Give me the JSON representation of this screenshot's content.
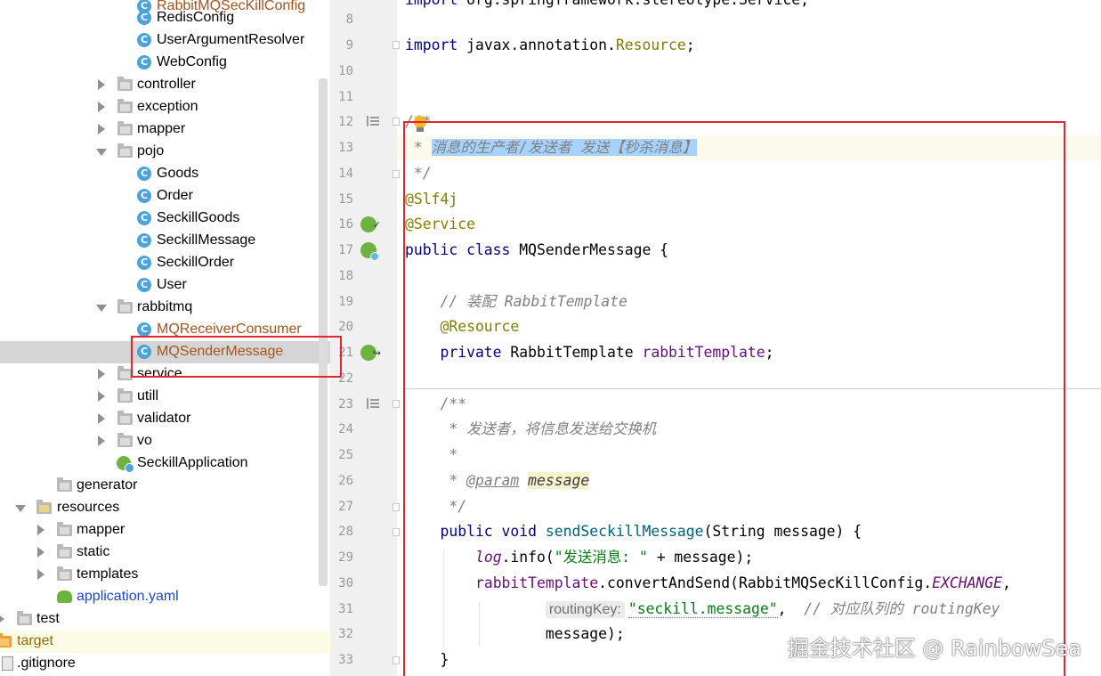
{
  "tree": {
    "items": [
      {
        "label": "RabbitMQSecKillConfig",
        "kind": "class",
        "partial": true
      },
      {
        "label": "RedisConfig",
        "kind": "class"
      },
      {
        "label": "UserArgumentResolver",
        "kind": "class"
      },
      {
        "label": "WebConfig",
        "kind": "class"
      },
      {
        "label": "controller",
        "kind": "folder",
        "state": "collapsed"
      },
      {
        "label": "exception",
        "kind": "folder",
        "state": "collapsed"
      },
      {
        "label": "mapper",
        "kind": "folder",
        "state": "collapsed"
      },
      {
        "label": "pojo",
        "kind": "folder",
        "state": "expanded"
      },
      {
        "label": "Goods",
        "kind": "class"
      },
      {
        "label": "Order",
        "kind": "class"
      },
      {
        "label": "SeckillGoods",
        "kind": "class"
      },
      {
        "label": "SeckillMessage",
        "kind": "class"
      },
      {
        "label": "SeckillOrder",
        "kind": "class"
      },
      {
        "label": "User",
        "kind": "class"
      },
      {
        "label": "rabbitmq",
        "kind": "folder",
        "state": "expanded"
      },
      {
        "label": "MQReceiverConsumer",
        "kind": "class",
        "status": "modified"
      },
      {
        "label": "MQSenderMessage",
        "kind": "class",
        "status": "modified",
        "selected": true
      },
      {
        "label": "service",
        "kind": "folder",
        "state": "collapsed"
      },
      {
        "label": "utill",
        "kind": "folder",
        "state": "collapsed"
      },
      {
        "label": "validator",
        "kind": "folder",
        "state": "collapsed"
      },
      {
        "label": "vo",
        "kind": "folder",
        "state": "collapsed"
      },
      {
        "label": "SeckillApplication",
        "kind": "spring-class"
      },
      {
        "label": "generator",
        "kind": "folder"
      },
      {
        "label": "resources",
        "kind": "resources-folder",
        "state": "expanded"
      },
      {
        "label": "mapper",
        "kind": "folder",
        "state": "collapsed"
      },
      {
        "label": "static",
        "kind": "folder",
        "state": "collapsed"
      },
      {
        "label": "templates",
        "kind": "folder",
        "state": "collapsed"
      },
      {
        "label": "application.yaml",
        "kind": "yaml"
      },
      {
        "label": "test",
        "kind": "folder",
        "state": "collapsed"
      },
      {
        "label": "target",
        "kind": "folder-orange"
      },
      {
        "label": ".gitignore",
        "kind": "file"
      }
    ]
  },
  "gutter": {
    "line_numbers": [
      "8",
      "9",
      "10",
      "11",
      "12",
      "13",
      "14",
      "15",
      "16",
      "17",
      "18",
      "19",
      "20",
      "21",
      "22",
      "23",
      "24",
      "25",
      "26",
      "27",
      "28",
      "29",
      "30",
      "31",
      "32",
      "33"
    ]
  },
  "code": {
    "l9_import": "import",
    "l9_pkg": " javax.annotation.",
    "l9_cls": "Resource",
    "l9_end": ";",
    "l12": "/**",
    "l13_star": " * ",
    "l13_text": "消息的生产者/发送者 发送【秒杀消息】",
    "l14": " */",
    "l15": "@Slf4j",
    "l16": "@Service",
    "l17_kw": "public class",
    "l17_name": " MQSenderMessage {",
    "l19": "    // 装配 RabbitTemplate",
    "l20": "    @Resource",
    "l21_kw": "    private",
    "l21_type": " RabbitTemplate ",
    "l21_field": "rabbitTemplate",
    "l21_end": ";",
    "l23": "    /**",
    "l24": "     * 发送者，将信息发送给交换机",
    "l25": "     *",
    "l26_star": "     * ",
    "l26_tag": "@param",
    "l26_sp": " ",
    "l26_name": "message",
    "l27": "     */",
    "l28_kw": "    public void",
    "l28_sp": " ",
    "l28_method": "sendSeckillMessage",
    "l28_rest": "(String message) {",
    "l29_ind": "        ",
    "l29_log": "log",
    "l29_mid": ".info(",
    "l29_str": "\"发送消息: \"",
    "l29_end": " + message);",
    "l30_ind": "        ",
    "l30_field": "rabbitTemplate",
    "l30_mid": ".convertAndSend(RabbitMQSecKillConfig.",
    "l30_const": "EXCHANGE",
    "l30_end": ",",
    "l31_ind": "                ",
    "l31_hint": "routingKey:",
    "l31_str": "\"seckill.message\"",
    "l31_sep": ",  ",
    "l31_cmt": "// 对应队列的 routingKey",
    "l32": "                message);",
    "l33": "    }"
  },
  "watermark": "掘金技术社区 @ RainbowSea",
  "colors": {
    "highlight_box": "#e0262e",
    "selection": "#a6d2ff",
    "keyword": "#000080",
    "annotation": "#808000",
    "field": "#660e7a",
    "string": "#067d17",
    "comment": "#808080"
  }
}
